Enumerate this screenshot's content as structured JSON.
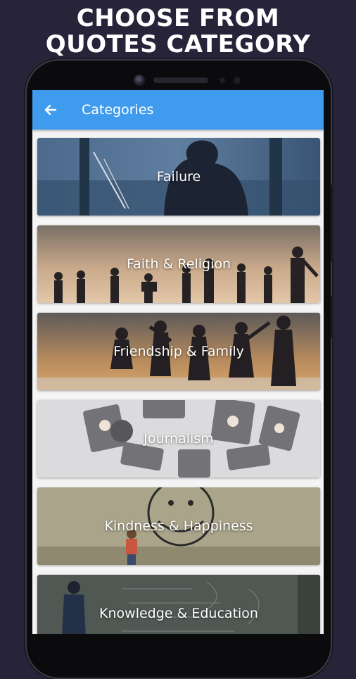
{
  "promo": {
    "line1": "CHOOSE FROM",
    "line2": "QUOTES CATEGORY"
  },
  "appbar": {
    "title": "Categories",
    "back_icon": "arrow-left-icon"
  },
  "categories": [
    {
      "label": "Failure"
    },
    {
      "label": "Faith & Religion"
    },
    {
      "label": "Friendship & Family"
    },
    {
      "label": "Journalism"
    },
    {
      "label": "Kindness & Happiness"
    },
    {
      "label": "Knowledge & Education"
    }
  ],
  "colors": {
    "background": "#27243a",
    "appbar": "#3f9bee",
    "screen": "#f4f4f5"
  }
}
